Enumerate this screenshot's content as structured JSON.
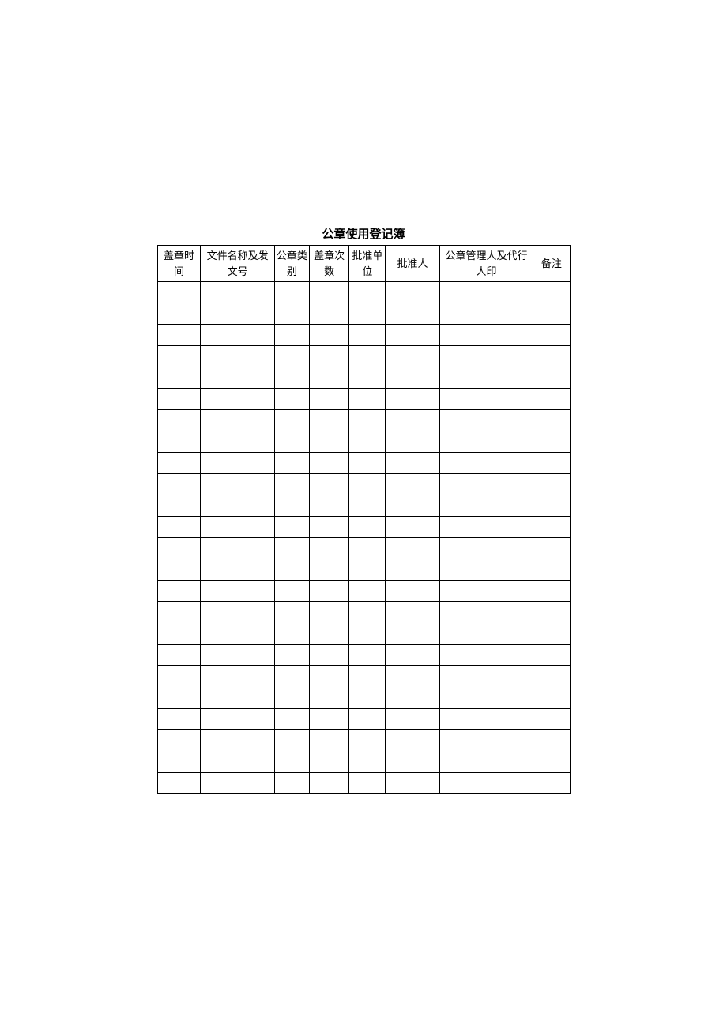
{
  "title": "公章使用登记簿",
  "headers": {
    "col1": "盖章时间",
    "col2": "文件名称及发文号",
    "col3": "公章类别",
    "col4": "盖章次数",
    "col5": "批准单位",
    "col6": "批准人",
    "col7": "公章管理人及代行人印",
    "col8": "备注"
  },
  "row_count": 24
}
